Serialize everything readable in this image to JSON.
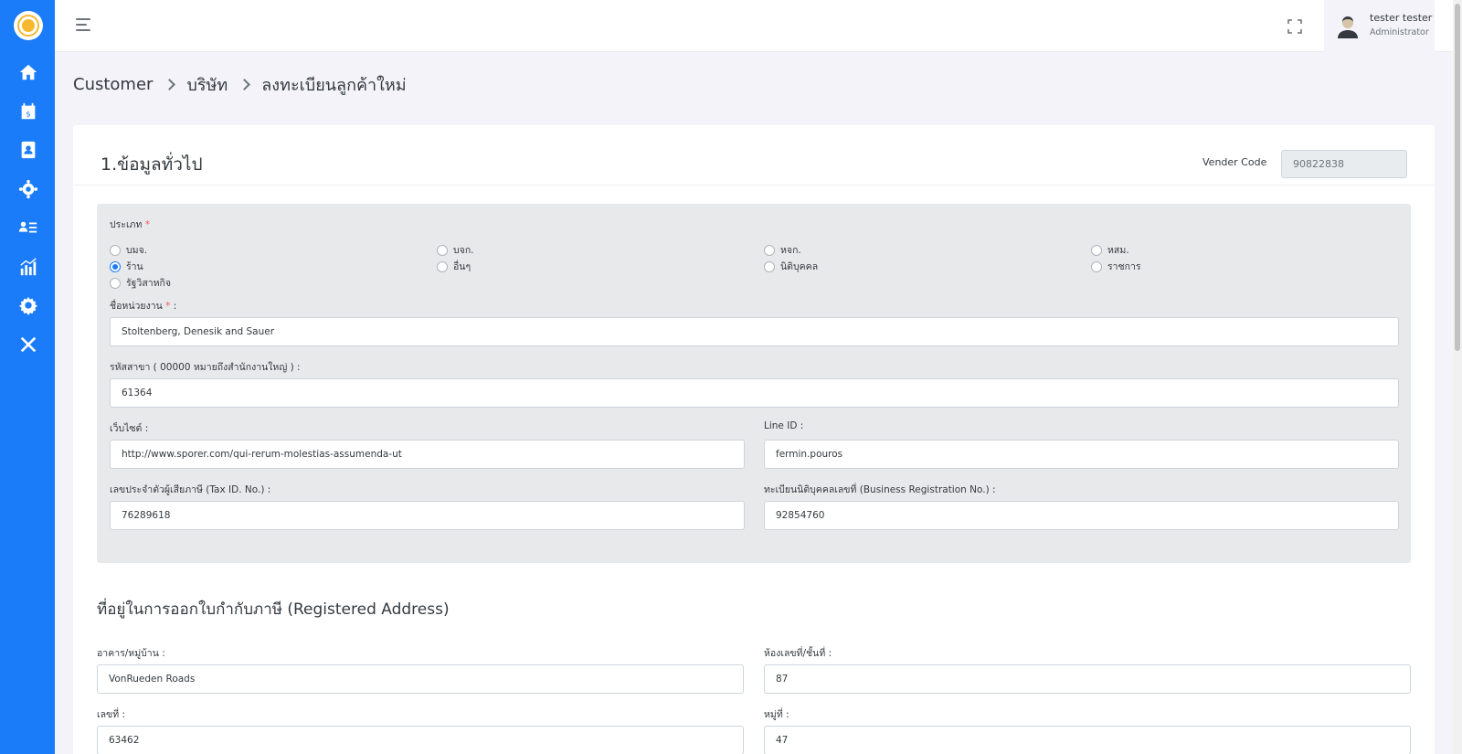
{
  "user": {
    "name": "tester tester",
    "role": "Administrator"
  },
  "breadcrumb": [
    "Customer",
    "บริษัท",
    "ลงทะเบียนลูกค้าใหม่"
  ],
  "section1": {
    "title": "1.ข้อมูลทั่วไป",
    "vender_code_label": "Vender Code",
    "vender_code_value": "90822838"
  },
  "type_field": {
    "label": "ประเภท",
    "required_mark": "*",
    "options": [
      "บมจ.",
      "บจก.",
      "หจก.",
      "หสม.",
      "ร้าน",
      "อื่นๆ",
      "นิติบุคคล",
      "ราชการ",
      "รัฐวิสาหกิจ"
    ],
    "selected": "ร้าน"
  },
  "unit_name": {
    "label": "ชื่อหน่วยงาน",
    "required_mark": "*",
    "colon": " :",
    "value": "Stoltenberg, Denesik and Sauer"
  },
  "branch_code": {
    "label": "รหัสสาขา ( 00000 หมายถึงสำนักงานใหญ่ ) :",
    "value": "61364"
  },
  "website": {
    "label": "เว็บไซต์ :",
    "value": "http://www.sporer.com/qui-rerum-molestias-assumenda-ut"
  },
  "line_id": {
    "label": "Line ID :",
    "value": "fermin.pouros"
  },
  "tax_id": {
    "label": "เลขประจำตัวผู้เสียภาษี (Tax ID. No.) :",
    "value": "76289618"
  },
  "business_reg": {
    "label": "ทะเบียนนิติบุคคลเลขที่ (Business Registration No.) :",
    "value": "92854760"
  },
  "address": {
    "title": "ที่อยู่ในการออกใบกำกับภาษี (Registered Address)",
    "building": {
      "label": "อาคาร/หมู่บ้าน :",
      "value": "VonRueden Roads"
    },
    "room": {
      "label": "ห้องเลขที่/ชั้นที่ :",
      "value": "87"
    },
    "number": {
      "label": "เลขที่ :",
      "value": "63462"
    },
    "moo": {
      "label": "หมู่ที่ :",
      "value": "47"
    }
  },
  "colors": {
    "sidebar": "#1a7cf9",
    "accent": "#1a7cf9",
    "required": "#f1556c"
  }
}
